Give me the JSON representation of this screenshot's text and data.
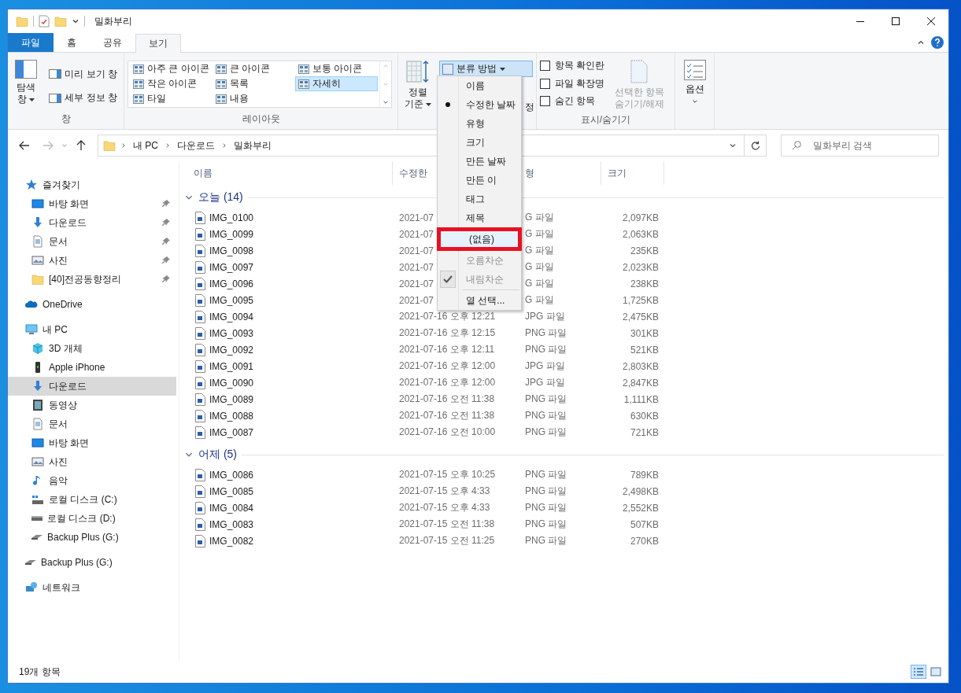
{
  "window": {
    "title": "밀화부리"
  },
  "ribbon_tabs": [
    {
      "label": "파일",
      "kind": "file",
      "selected": false
    },
    {
      "label": "홈",
      "kind": "tab",
      "selected": false
    },
    {
      "label": "공유",
      "kind": "tab",
      "selected": false
    },
    {
      "label": "보기",
      "kind": "tab",
      "selected": true
    }
  ],
  "ribbon": {
    "panes": {
      "label": "창",
      "navigation_pane": "탐색 창",
      "items": [
        "미리 보기 창",
        "세부 정보 창"
      ]
    },
    "layout": {
      "label": "레이아웃",
      "options": [
        {
          "label": "아주 큰 아이콘",
          "selected": false
        },
        {
          "label": "큰 아이콘",
          "selected": false
        },
        {
          "label": "보통 아이콘",
          "selected": false
        },
        {
          "label": "작은 아이콘",
          "selected": false
        },
        {
          "label": "목록",
          "selected": false
        },
        {
          "label": "자세히",
          "selected": true
        },
        {
          "label": "타일",
          "selected": false
        },
        {
          "label": "내용",
          "selected": false
        }
      ]
    },
    "current_view": {
      "sort_by": "정렬 기준",
      "group_by": {
        "label": "분류 방법",
        "pressed": true
      },
      "partial_label": "정"
    },
    "show_hide": {
      "label": "표시/숨기기",
      "checkboxes": [
        {
          "label": "항목 확인란",
          "checked": false
        },
        {
          "label": "파일 확장명",
          "checked": false
        },
        {
          "label": "숨긴 항목",
          "checked": false
        }
      ],
      "hide_selected": {
        "label": "선택한 항목 숨기기/해제",
        "disabled": true
      }
    },
    "options": {
      "label": "옵션"
    }
  },
  "address_bar": {
    "path": [
      "내 PC",
      "다운로드",
      "밀화부리"
    ]
  },
  "search": {
    "placeholder": "밀화부리 검색"
  },
  "sidebar": {
    "items": [
      {
        "label": "즐겨찾기",
        "kind": "star",
        "selected": false,
        "children": [
          {
            "label": "바탕 화면",
            "kind": "desktop",
            "pinned": true,
            "selected": false
          },
          {
            "label": "다운로드",
            "kind": "download",
            "pinned": true,
            "selected": false
          },
          {
            "label": "문서",
            "kind": "document",
            "pinned": true,
            "selected": false
          },
          {
            "label": "사진",
            "kind": "pictures",
            "pinned": true,
            "selected": false
          },
          {
            "label": "[40]전공동향정리",
            "kind": "folder",
            "pinned": true,
            "selected": false
          }
        ]
      },
      {
        "label": "OneDrive",
        "kind": "cloud",
        "selected": false
      },
      {
        "label": "내 PC",
        "kind": "pc",
        "selected": false,
        "children": [
          {
            "label": "3D 개체",
            "kind": "cube",
            "selected": false
          },
          {
            "label": "Apple iPhone",
            "kind": "phone",
            "selected": false
          },
          {
            "label": "다운로드",
            "kind": "download",
            "selected": true
          },
          {
            "label": "동영상",
            "kind": "video",
            "selected": false
          },
          {
            "label": "문서",
            "kind": "document",
            "selected": false
          },
          {
            "label": "바탕 화면",
            "kind": "desktop",
            "selected": false
          },
          {
            "label": "사진",
            "kind": "pictures",
            "selected": false
          },
          {
            "label": "음악",
            "kind": "music",
            "selected": false
          },
          {
            "label": "로컬 디스크 (C:)",
            "kind": "system-drive",
            "selected": false
          },
          {
            "label": "로컬 디스크 (D:)",
            "kind": "drive",
            "selected": false
          },
          {
            "label": "Backup Plus (G:)",
            "kind": "usb-drive",
            "selected": false
          }
        ]
      },
      {
        "label": "Backup Plus (G:)",
        "kind": "usb-drive",
        "selected": false
      },
      {
        "label": "네트워크",
        "kind": "network",
        "selected": false
      }
    ]
  },
  "columns": [
    "이름",
    "수정한",
    "형",
    "크기"
  ],
  "groups": [
    {
      "label": "오늘 (14)",
      "expanded": true,
      "rows": [
        {
          "name": "IMG_0100",
          "date": "2021-07",
          "type": "G 파일",
          "size": "2,097KB"
        },
        {
          "name": "IMG_0099",
          "date": "2021-07",
          "type": "G 파일",
          "size": "2,063KB"
        },
        {
          "name": "IMG_0098",
          "date": "2021-07",
          "type": "G 파일",
          "size": "235KB"
        },
        {
          "name": "IMG_0097",
          "date": "2021-07",
          "type": "G 파일",
          "size": "2,023KB"
        },
        {
          "name": "IMG_0096",
          "date": "2021-07",
          "type": "G 파일",
          "size": "238KB"
        },
        {
          "name": "IMG_0095",
          "date": "2021-07",
          "type": "G 파일",
          "size": "1,725KB"
        },
        {
          "name": "IMG_0094",
          "date": "2021-07-16 오후 12:21",
          "type": "JPG 파일",
          "size": "2,475KB"
        },
        {
          "name": "IMG_0093",
          "date": "2021-07-16 오후 12:15",
          "type": "PNG 파일",
          "size": "301KB"
        },
        {
          "name": "IMG_0092",
          "date": "2021-07-16 오후 12:11",
          "type": "PNG 파일",
          "size": "521KB"
        },
        {
          "name": "IMG_0091",
          "date": "2021-07-16 오후 12:00",
          "type": "JPG 파일",
          "size": "2,803KB"
        },
        {
          "name": "IMG_0090",
          "date": "2021-07-16 오후 12:00",
          "type": "JPG 파일",
          "size": "2,847KB"
        },
        {
          "name": "IMG_0089",
          "date": "2021-07-16 오전 11:38",
          "type": "PNG 파일",
          "size": "1,111KB"
        },
        {
          "name": "IMG_0088",
          "date": "2021-07-16 오전 11:38",
          "type": "PNG 파일",
          "size": "630KB"
        },
        {
          "name": "IMG_0087",
          "date": "2021-07-16 오전 10:00",
          "type": "PNG 파일",
          "size": "721KB"
        }
      ]
    },
    {
      "label": "어제 (5)",
      "expanded": true,
      "rows": [
        {
          "name": "IMG_0086",
          "date": "2021-07-15 오후 10:25",
          "type": "PNG 파일",
          "size": "789KB"
        },
        {
          "name": "IMG_0085",
          "date": "2021-07-15 오후 4:33",
          "type": "PNG 파일",
          "size": "2,498KB"
        },
        {
          "name": "IMG_0084",
          "date": "2021-07-15 오후 4:33",
          "type": "PNG 파일",
          "size": "2,552KB"
        },
        {
          "name": "IMG_0083",
          "date": "2021-07-15 오전 11:38",
          "type": "PNG 파일",
          "size": "507KB"
        },
        {
          "name": "IMG_0082",
          "date": "2021-07-15 오전 11:25",
          "type": "PNG 파일",
          "size": "270KB"
        }
      ]
    }
  ],
  "menu": {
    "items": [
      {
        "kind": "option",
        "label": "이름",
        "bullet": false,
        "check": false,
        "highlighted": false,
        "disabled": false
      },
      {
        "kind": "option",
        "label": "수정한 날짜",
        "bullet": true,
        "check": false,
        "highlighted": false,
        "disabled": false
      },
      {
        "kind": "option",
        "label": "유형",
        "bullet": false,
        "check": false,
        "highlighted": false,
        "disabled": false
      },
      {
        "kind": "option",
        "label": "크기",
        "bullet": false,
        "check": false,
        "highlighted": false,
        "disabled": false
      },
      {
        "kind": "option",
        "label": "만든 날짜",
        "bullet": false,
        "check": false,
        "highlighted": false,
        "disabled": false
      },
      {
        "kind": "option",
        "label": "만든 이",
        "bullet": false,
        "check": false,
        "highlighted": false,
        "disabled": false
      },
      {
        "kind": "option",
        "label": "태그",
        "bullet": false,
        "check": false,
        "highlighted": false,
        "disabled": false
      },
      {
        "kind": "option",
        "label": "제목",
        "bullet": false,
        "check": false,
        "highlighted": false,
        "disabled": false
      },
      {
        "kind": "option",
        "label": "(없음)",
        "bullet": false,
        "check": false,
        "highlighted": true,
        "disabled": false
      },
      {
        "kind": "option",
        "label": "오름차순",
        "bullet": false,
        "check": false,
        "highlighted": false,
        "disabled": true
      },
      {
        "kind": "option",
        "label": "내림차순",
        "bullet": false,
        "check": true,
        "highlighted": false,
        "disabled": true
      },
      {
        "kind": "separator"
      },
      {
        "kind": "option",
        "label": "열 선택...",
        "bullet": false,
        "check": false,
        "highlighted": false,
        "disabled": false
      }
    ]
  },
  "status_bar": {
    "count": "19개 항목",
    "views": [
      {
        "kind": "details",
        "selected": true
      },
      {
        "kind": "large-icons",
        "selected": false
      }
    ]
  }
}
